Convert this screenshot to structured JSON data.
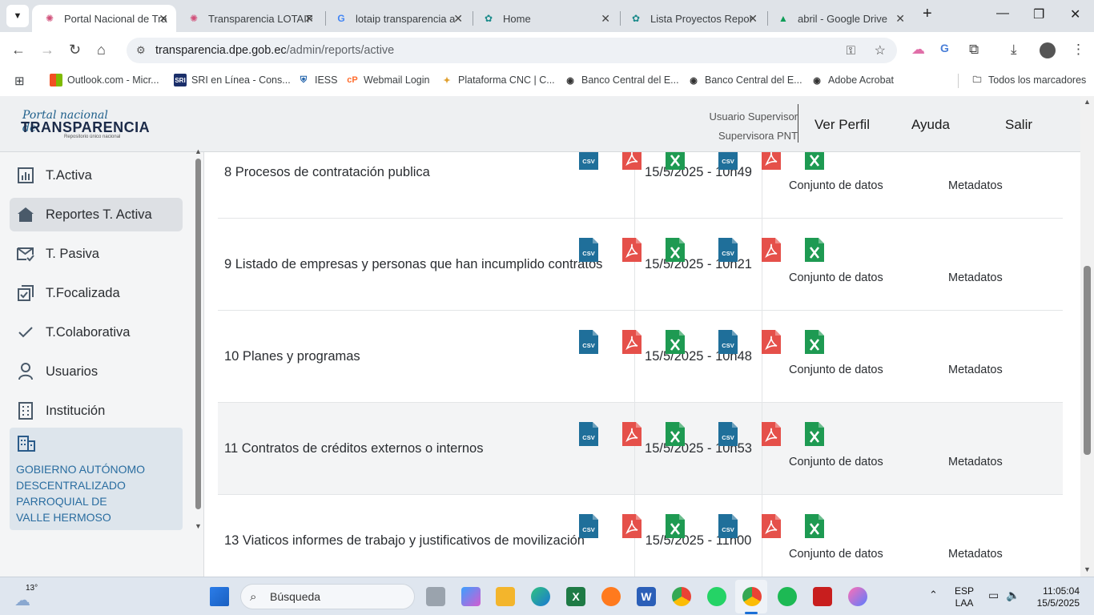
{
  "browser": {
    "tabs": [
      {
        "title": "Portal Nacional de Tra",
        "active": true,
        "icon": "portal-icon"
      },
      {
        "title": "Transparencia LOTAIP",
        "active": false,
        "icon": "portal-icon"
      },
      {
        "title": "lotaip transparencia a",
        "active": false,
        "icon": "google-icon"
      },
      {
        "title": "Home",
        "active": false,
        "icon": "globe-icon"
      },
      {
        "title": "Lista Proyectos Repor",
        "active": false,
        "icon": "globe-icon"
      },
      {
        "title": "abril - Google Drive",
        "active": false,
        "icon": "drive-icon"
      }
    ],
    "url_host": "transparencia.dpe.gob.ec",
    "url_path": "/admin/reports/active",
    "bookmarks": [
      {
        "label": "Outlook.com - Micr...",
        "icon": "ms-icon"
      },
      {
        "label": "SRI en Línea - Cons...",
        "icon": "sri-icon"
      },
      {
        "label": "IESS",
        "icon": "iess-icon"
      },
      {
        "label": "Webmail Login",
        "icon": "cpanel-icon"
      },
      {
        "label": "Plataforma CNC | C...",
        "icon": "cnc-icon"
      },
      {
        "label": "Banco Central del E...",
        "icon": "globe-icon"
      },
      {
        "label": "Banco Central del E...",
        "icon": "globe-icon"
      },
      {
        "label": "Adobe Acrobat",
        "icon": "globe-icon"
      }
    ],
    "all_bookmarks": "Todos los marcadores"
  },
  "app": {
    "logo_line1": "Portal nacional de",
    "logo_line2": "TRANSPARENCIA",
    "logo_line3": "Repositorio único nacional",
    "user_role": "Usuario Supervisor",
    "user_name": "Supervisora PNT",
    "nav": {
      "profile": "Ver Perfil",
      "help": "Ayuda",
      "logout": "Salir"
    }
  },
  "sidebar": {
    "items": [
      {
        "label": "T.Activa",
        "icon": "chart-icon",
        "active": false
      },
      {
        "label": "Reportes T. Activa",
        "icon": "home-icon",
        "active": true
      },
      {
        "label": "T. Pasiva",
        "icon": "mail-check-icon",
        "active": false
      },
      {
        "label": "T.Focalizada",
        "icon": "copy-check-icon",
        "active": false
      },
      {
        "label": "T.Colaborativa",
        "icon": "check-icon",
        "active": false
      },
      {
        "label": "Usuarios",
        "icon": "user-icon",
        "active": false
      },
      {
        "label": "Institución",
        "icon": "building-icon",
        "active": false
      }
    ],
    "institution": [
      "GOBIERNO AUTÓNOMO",
      "DESCENTRALIZADO",
      "PARROQUIAL DE",
      "VALLE HERMOSO"
    ]
  },
  "table": {
    "group_labels": {
      "data": "Conjunto de datos",
      "meta": "Metadatos"
    },
    "rows": [
      {
        "name": "8 Procesos de contratación publica",
        "date": "15/5/2025 - 10h49"
      },
      {
        "name": "9 Listado de empresas y personas que han incumplido contratos",
        "date": "15/5/2025 - 10h21"
      },
      {
        "name": "10 Planes y programas",
        "date": "15/5/2025 - 10h48"
      },
      {
        "name": "11 Contratos de créditos externos o internos",
        "date": "15/5/2025 - 10h53"
      },
      {
        "name": "13 Viaticos informes de trabajo y justificativos de movilización",
        "date": "15/5/2025 - 11h00"
      }
    ],
    "file_types": [
      "csv",
      "pdf",
      "xlsx"
    ],
    "colors": {
      "csv": "#1f6f9a",
      "pdf": "#e5504a",
      "xlsx": "#1e9a52"
    }
  },
  "taskbar": {
    "weather_temp": "13°",
    "search_placeholder": "Búsqueda",
    "lang1": "ESP",
    "lang2": "LAA",
    "time": "11:05:04",
    "date": "15/5/2025"
  }
}
